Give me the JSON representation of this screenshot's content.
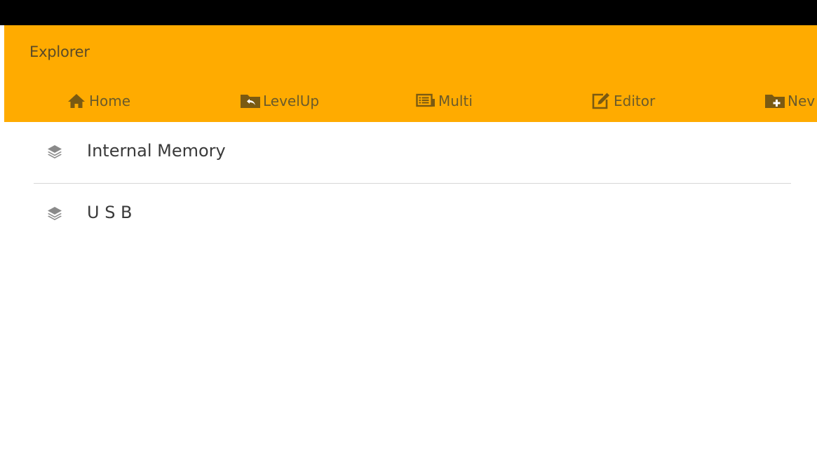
{
  "app": {
    "title": "Explorer"
  },
  "toolbar": {
    "items": [
      {
        "label": "Home",
        "icon": "home-icon"
      },
      {
        "label": "LevelUp",
        "icon": "folder-level-up-icon"
      },
      {
        "label": "Multi",
        "icon": "multi-select-icon"
      },
      {
        "label": "Editor",
        "icon": "edit-icon"
      },
      {
        "label": "Nev",
        "icon": "new-folder-icon"
      }
    ]
  },
  "storage": {
    "items": [
      {
        "label": "Internal Memory",
        "icon": "layers-icon"
      },
      {
        "label": "U S B",
        "icon": "layers-icon"
      }
    ]
  },
  "colors": {
    "app_bar": "#FFAB00",
    "toolbar_text": "#6b5a2a",
    "list_text": "#3a3a3a",
    "list_icon": "#8a8a8a",
    "status_bar": "#000000"
  }
}
